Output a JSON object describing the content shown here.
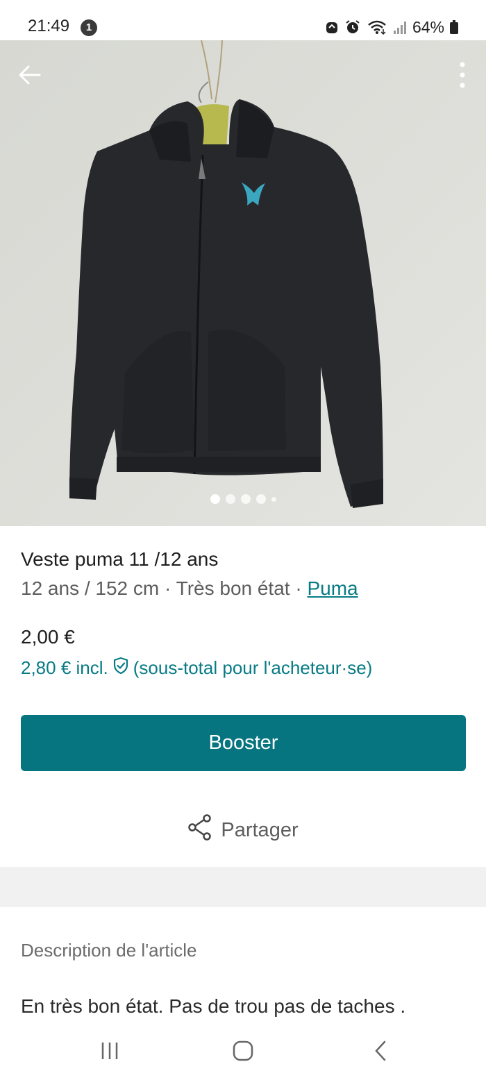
{
  "status_bar": {
    "time": "21:49",
    "notification_count": "1",
    "battery": "64%"
  },
  "photo": {
    "subject": "black hooded zip jacket with blue logo",
    "image_count": 5,
    "active_index": 0
  },
  "item": {
    "title": "Veste puma 11 /12 ans",
    "size": "12 ans / 152 cm",
    "separator": " · ",
    "condition": "Très bon état",
    "brand": "Puma",
    "price": "2,00 €",
    "price_incl": "2,80 € incl.",
    "price_incl_note": "(sous-total pour l'acheteur·se)"
  },
  "actions": {
    "booster_label": "Booster",
    "share_label": "Partager"
  },
  "description": {
    "heading": "Description de l'article",
    "text": "En très bon état. Pas de trou pas de taches ."
  },
  "colors": {
    "accent": "#077580",
    "link": "#087b85"
  }
}
